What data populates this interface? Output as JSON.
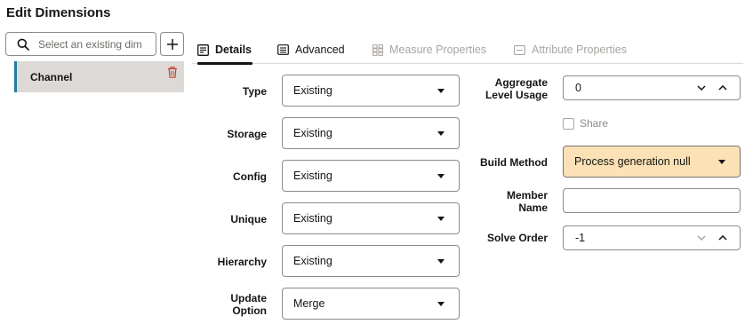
{
  "page": {
    "title": "Edit Dimensions"
  },
  "sidebar": {
    "search": {
      "placeholder": "Select an existing dim"
    },
    "items": [
      {
        "label": "Channel"
      }
    ]
  },
  "tabs": [
    {
      "label": "Details",
      "state": "active"
    },
    {
      "label": "Advanced",
      "state": "normal"
    },
    {
      "label": "Measure Properties",
      "state": "disabled"
    },
    {
      "label": "Attribute Properties",
      "state": "disabled"
    }
  ],
  "form": {
    "type": {
      "label": "Type",
      "value": "Existing"
    },
    "storage": {
      "label": "Storage",
      "value": "Existing"
    },
    "config": {
      "label": "Config",
      "value": "Existing"
    },
    "unique": {
      "label": "Unique",
      "value": "Existing"
    },
    "hierarchy": {
      "label": "Hierarchy",
      "value": "Existing"
    },
    "update_option": {
      "label_line1": "Update",
      "label_line2": "Option",
      "value": "Merge"
    },
    "aggregate_level_usage": {
      "label_line1": "Aggregate",
      "label_line2": "Level Usage",
      "value": "0"
    },
    "share": {
      "label": "Share",
      "checked": false
    },
    "build_method": {
      "label": "Build Method",
      "value": "Process generation null"
    },
    "member_name": {
      "label_line1": "Member",
      "label_line2": "Name",
      "value": ""
    },
    "solve_order": {
      "label": "Solve Order",
      "value": "-1"
    }
  },
  "colors": {
    "accent_bar": "#227e9e",
    "selected_item_bg": "#dcd9d6",
    "highlight_select_bg": "#fbe1b5",
    "delete_icon": "#c74634"
  },
  "icons": {
    "search": "search-icon",
    "add": "plus-icon",
    "delete": "trash-icon",
    "details_tab": "details-icon",
    "advanced_tab": "advanced-icon",
    "measure_tab": "measure-grid-icon",
    "attribute_tab": "attribute-icon",
    "chevron_down": "chevron-down-icon",
    "chevron_up": "chevron-up-icon"
  }
}
